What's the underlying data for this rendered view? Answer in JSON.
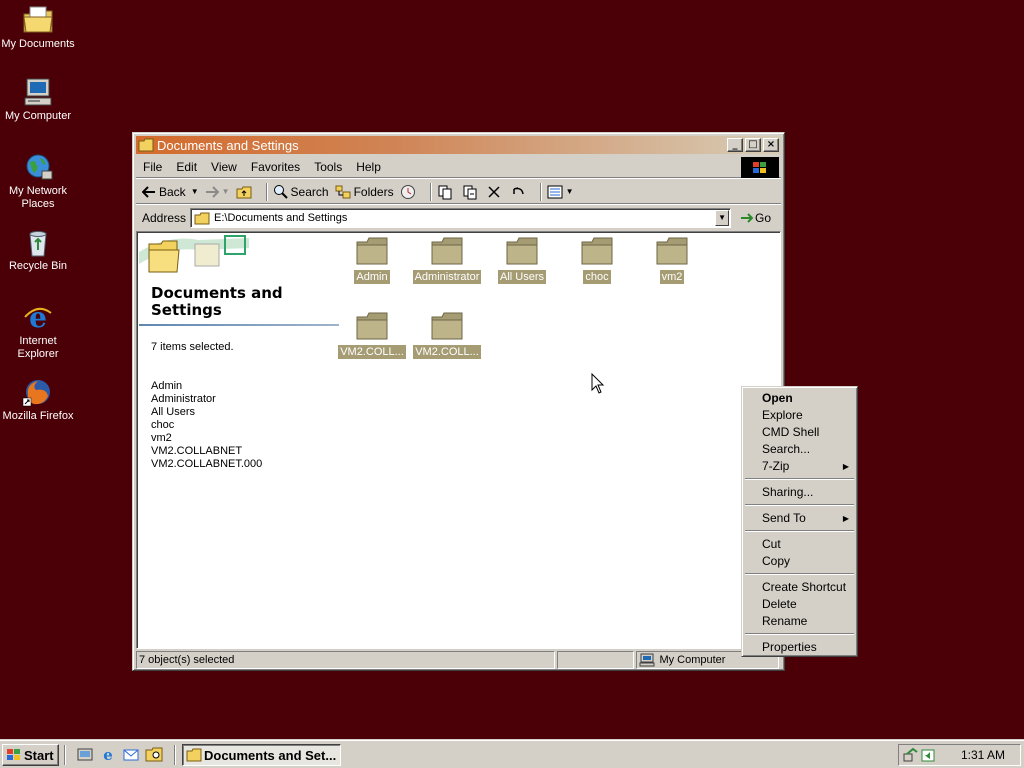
{
  "desktop": {
    "icons": [
      {
        "label": "My Documents",
        "icon": "my-documents-icon"
      },
      {
        "label": "My Computer",
        "icon": "my-computer-icon"
      },
      {
        "label": "My Network Places",
        "icon": "network-places-icon"
      },
      {
        "label": "Recycle Bin",
        "icon": "recycle-bin-icon"
      },
      {
        "label": "Internet Explorer",
        "icon": "internet-explorer-icon"
      },
      {
        "label": "Mozilla Firefox",
        "icon": "firefox-icon"
      }
    ]
  },
  "window": {
    "title": "Documents and Settings",
    "menu": [
      "File",
      "Edit",
      "View",
      "Favorites",
      "Tools",
      "Help"
    ],
    "toolbar": {
      "back": "Back",
      "search": "Search",
      "folders": "Folders"
    },
    "address": {
      "label": "Address",
      "value": "E:\\Documents and Settings",
      "go": "Go"
    },
    "left_pane": {
      "title": "Documents and Settings",
      "selected_count": "7 items selected.",
      "selected_items": [
        "Admin",
        "Administrator",
        "All Users",
        "choc",
        "vm2",
        "VM2.COLLABNET",
        "VM2.COLLABNET.000"
      ]
    },
    "folders": [
      "Admin",
      "Administrator",
      "All Users",
      "choc",
      "vm2",
      "VM2.COLL...",
      "VM2.COLL..."
    ],
    "status": {
      "selected": "7 object(s) selected",
      "zone": "My Computer"
    }
  },
  "context_menu": {
    "items": [
      "Open",
      "Explore",
      "CMD Shell",
      "Search...",
      "7-Zip",
      "Sharing...",
      "Send To",
      "Cut",
      "Copy",
      "Create Shortcut",
      "Delete",
      "Rename",
      "Properties"
    ]
  },
  "taskbar": {
    "start": "Start",
    "task": "Documents and Set...",
    "clock": "1:31 AM"
  },
  "colors": {
    "desktop": "#4a0006",
    "titlebar_start": "#d36b2d",
    "selection": "#a59c74"
  }
}
